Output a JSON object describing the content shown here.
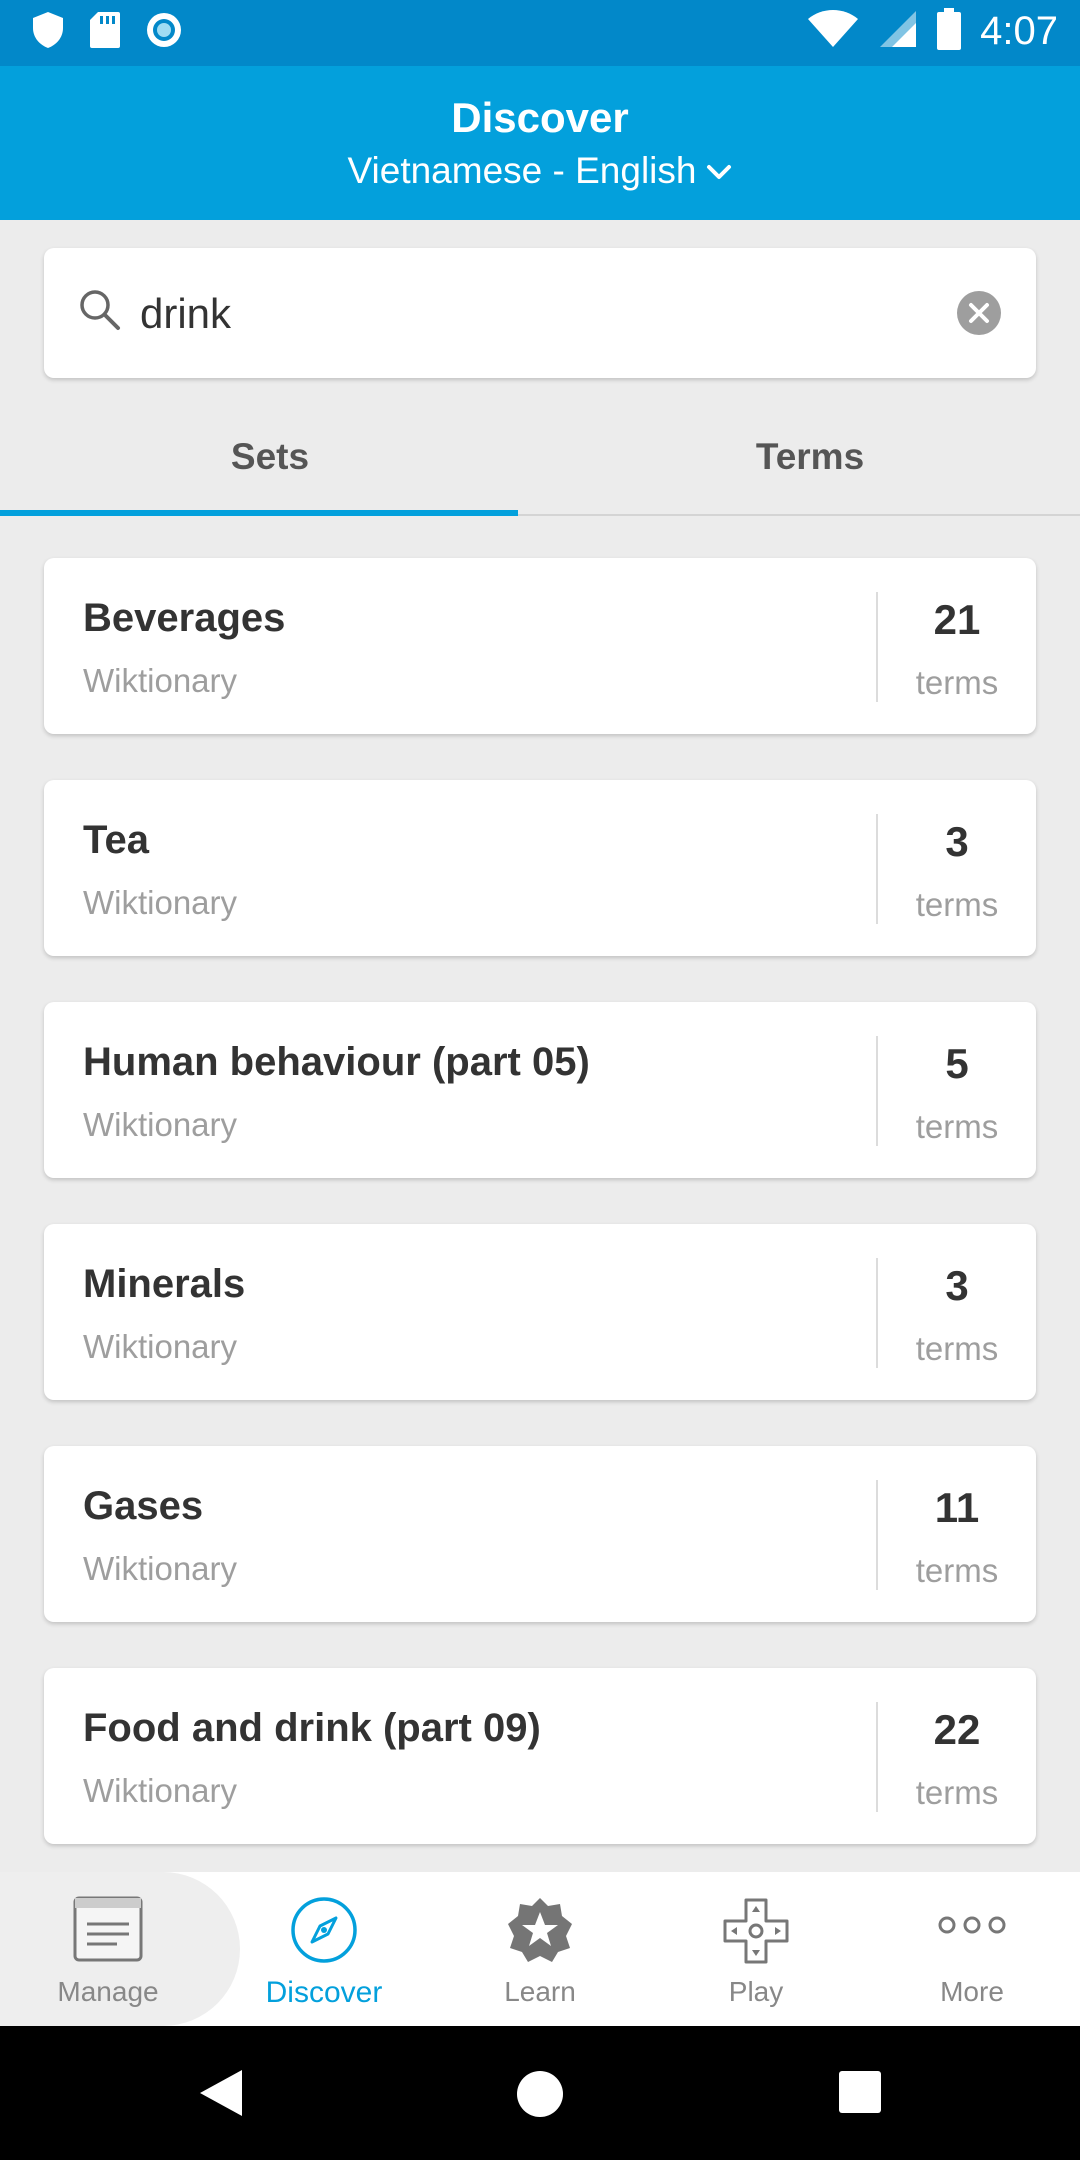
{
  "status_bar": {
    "time": "4:07",
    "left_icons": [
      "shield-icon",
      "sd-card-icon",
      "circle-icon"
    ],
    "right_icons": [
      "wifi-icon",
      "signal-icon",
      "battery-icon"
    ]
  },
  "app_bar": {
    "title": "Discover",
    "language_pair": "Vietnamese - English"
  },
  "search": {
    "value": "drink",
    "placeholder": ""
  },
  "tabs": [
    {
      "label": "Sets",
      "selected": true
    },
    {
      "label": "Terms",
      "selected": false
    }
  ],
  "sets": [
    {
      "title": "Beverages",
      "source": "Wiktionary",
      "count": "21",
      "unit": "terms"
    },
    {
      "title": "Tea",
      "source": "Wiktionary",
      "count": "3",
      "unit": "terms"
    },
    {
      "title": "Human behaviour (part 05)",
      "source": "Wiktionary",
      "count": "5",
      "unit": "terms"
    },
    {
      "title": "Minerals",
      "source": "Wiktionary",
      "count": "3",
      "unit": "terms"
    },
    {
      "title": "Gases",
      "source": "Wiktionary",
      "count": "11",
      "unit": "terms"
    },
    {
      "title": "Food and drink (part 09)",
      "source": "Wiktionary",
      "count": "22",
      "unit": "terms"
    }
  ],
  "bottom_nav": [
    {
      "label": "Manage",
      "icon": "document-icon",
      "active": false
    },
    {
      "label": "Discover",
      "icon": "compass-icon",
      "active": true
    },
    {
      "label": "Learn",
      "icon": "star-badge-icon",
      "active": false
    },
    {
      "label": "Play",
      "icon": "gamepad-icon",
      "active": false
    },
    {
      "label": "More",
      "icon": "more-dots-icon",
      "active": false
    }
  ],
  "colors": {
    "status_bar": "#0288c9",
    "app_bar": "#03a0dc",
    "accent": "#03a0dc",
    "background": "#ececec"
  }
}
